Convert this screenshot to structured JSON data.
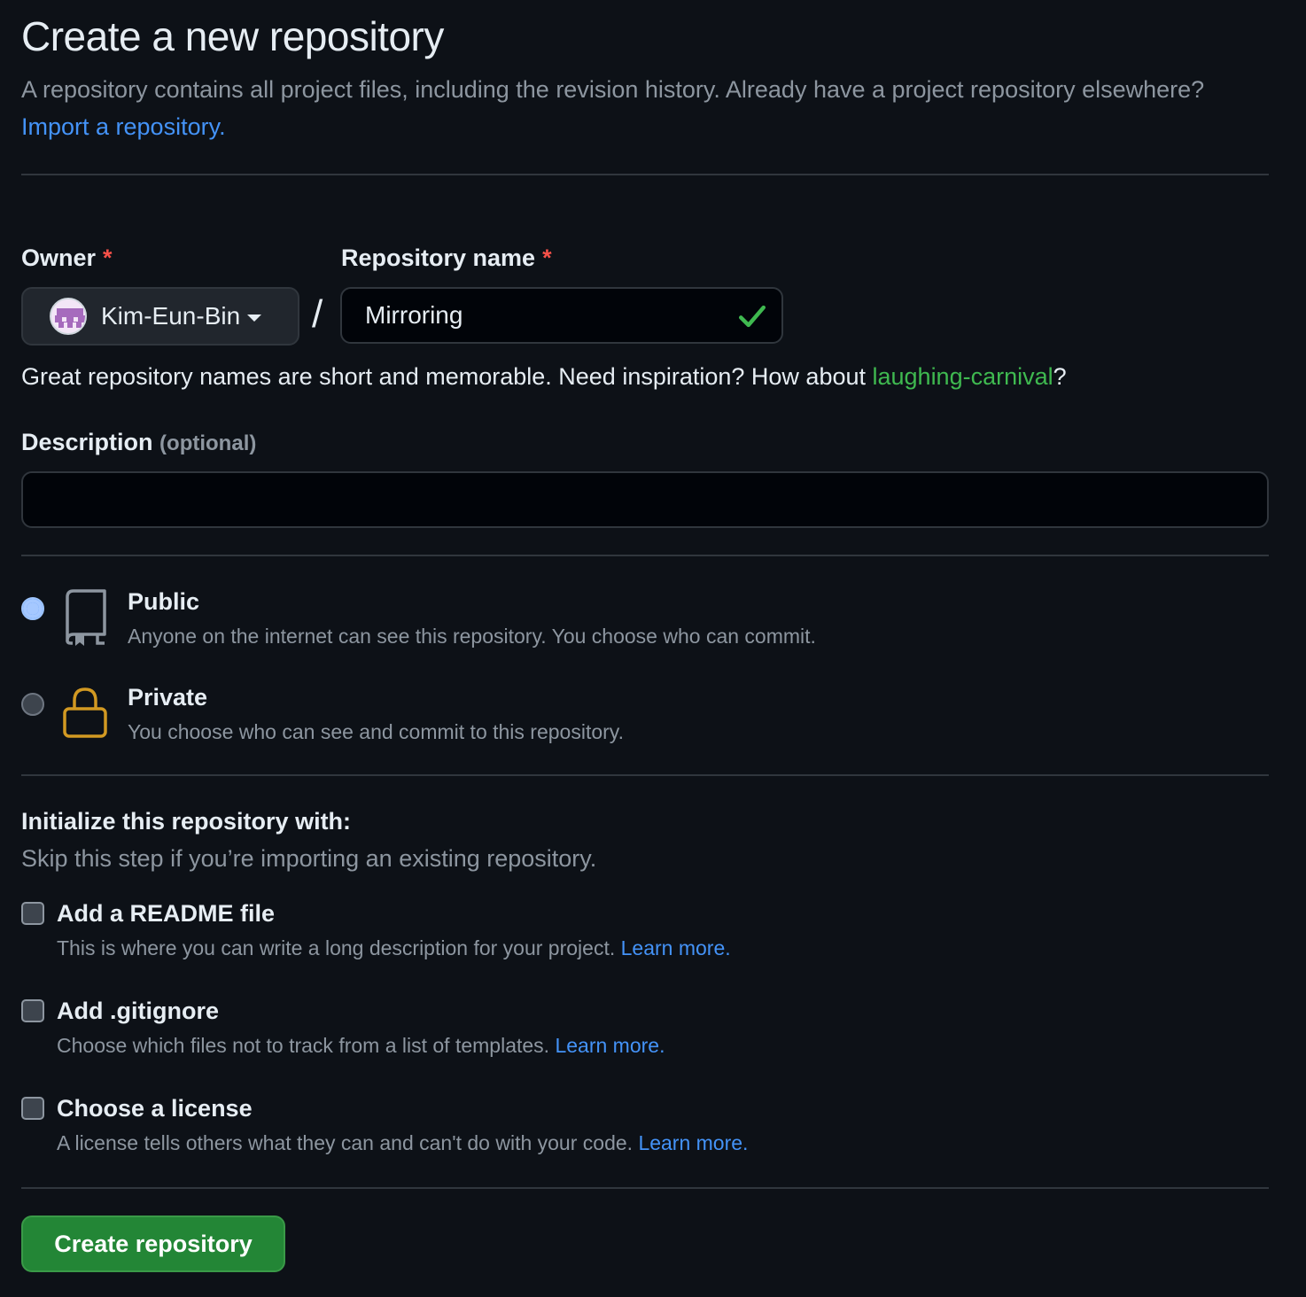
{
  "header": {
    "title": "Create a new repository",
    "subtitle_text": "A repository contains all project files, including the revision history. Already have a project repository elsewhere?",
    "import_link": "Import a repository."
  },
  "owner": {
    "label": "Owner",
    "required_marker": "*",
    "selected": "Kim-Eun-Bin"
  },
  "separator": "/",
  "repo_name": {
    "label": "Repository name",
    "required_marker": "*",
    "value": "Mirroring",
    "valid": true
  },
  "suggestion": {
    "text_before": "Great repository names are short and memorable. Need inspiration? How about ",
    "suggested_name": "laughing-carnival",
    "text_after": "?"
  },
  "description": {
    "label": "Description",
    "optional_text": "(optional)",
    "value": ""
  },
  "visibility": {
    "options": [
      {
        "title": "Public",
        "desc": "Anyone on the internet can see this repository. You choose who can commit.",
        "checked": true,
        "icon": "repo-icon"
      },
      {
        "title": "Private",
        "desc": "You choose who can see and commit to this repository.",
        "checked": false,
        "icon": "lock-icon"
      }
    ]
  },
  "initialize": {
    "title": "Initialize this repository with:",
    "subtitle": "Skip this step if you’re importing an existing repository.",
    "options": [
      {
        "title": "Add a README file",
        "desc": "This is where you can write a long description for your project.",
        "link": "Learn more.",
        "checked": false
      },
      {
        "title": "Add .gitignore",
        "desc": "Choose which files not to track from a list of templates.",
        "link": "Learn more.",
        "checked": false
      },
      {
        "title": "Choose a license",
        "desc": "A license tells others what they can and can't do with your code.",
        "link": "Learn more.",
        "checked": false
      }
    ]
  },
  "submit": {
    "label": "Create repository"
  },
  "colors": {
    "background": "#0d1117",
    "accent_link": "#4493f8",
    "success_green": "#3fb950",
    "primary_button": "#238636",
    "required_red": "#f85149",
    "lock_icon": "#d29922"
  }
}
